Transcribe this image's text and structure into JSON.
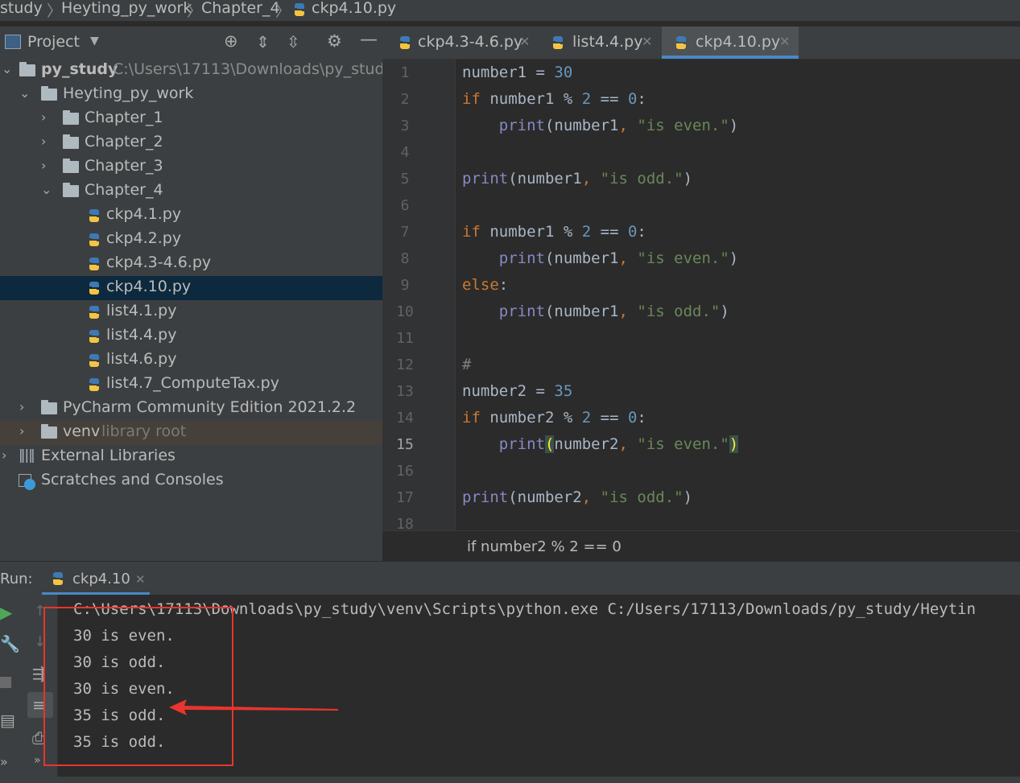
{
  "breadcrumb": [
    "study",
    "Heyting_py_work",
    "Chapter_4",
    "ckp4.10.py"
  ],
  "project": {
    "title": "Project",
    "tree": [
      {
        "label": "py_study",
        "hint": "C:\\Users\\17113\\Downloads\\py_study"
      },
      {
        "label": "Heyting_py_work"
      },
      {
        "label": "Chapter_1"
      },
      {
        "label": "Chapter_2"
      },
      {
        "label": "Chapter_3"
      },
      {
        "label": "Chapter_4"
      },
      {
        "label": "ckp4.1.py"
      },
      {
        "label": "ckp4.2.py"
      },
      {
        "label": "ckp4.3-4.6.py"
      },
      {
        "label": "ckp4.10.py"
      },
      {
        "label": "list4.1.py"
      },
      {
        "label": "list4.4.py"
      },
      {
        "label": "list4.6.py"
      },
      {
        "label": "list4.7_ComputeTax.py"
      },
      {
        "label": "PyCharm Community Edition 2021.2.2"
      },
      {
        "label": "venv",
        "hint": "library root"
      },
      {
        "label": "External Libraries"
      },
      {
        "label": "Scratches and Consoles"
      }
    ]
  },
  "tabs": [
    {
      "label": "ckp4.3-4.6.py"
    },
    {
      "label": "list4.4.py"
    },
    {
      "label": "ckp4.10.py"
    }
  ],
  "editor": {
    "line_numbers": [
      "1",
      "2",
      "3",
      "4",
      "5",
      "6",
      "7",
      "8",
      "9",
      "10",
      "11",
      "12",
      "13",
      "14",
      "15",
      "16",
      "17",
      "18"
    ],
    "current_line": "15",
    "breadcrumb": "if number2 % 2 == 0"
  },
  "run": {
    "label": "Run:",
    "tab": "ckp4.10",
    "console": [
      "C:\\Users\\17113\\Downloads\\py_study\\venv\\Scripts\\python.exe C:/Users/17113/Downloads/py_study/Heytin",
      "30 is even.",
      "30 is odd.",
      "30 is even.",
      "35 is odd.",
      "35 is odd."
    ]
  },
  "colors": {
    "keyword": "#cc7832",
    "number": "#6897bb",
    "string": "#6a8759",
    "builtin": "#8888c6",
    "annotation": "#e8352d",
    "selection": "#0d293e"
  }
}
